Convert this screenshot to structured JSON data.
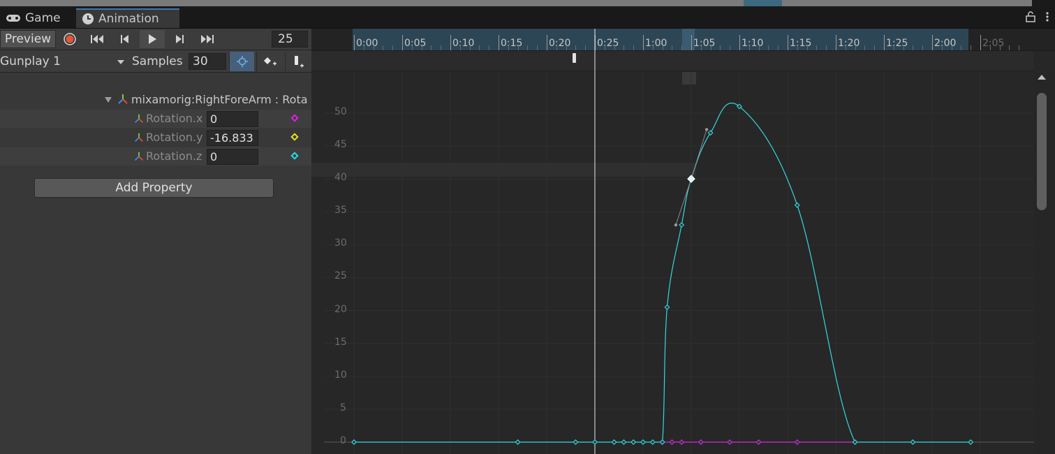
{
  "tabs": [
    {
      "label": "Game",
      "icon": "gamepad-icon"
    },
    {
      "label": "Animation",
      "icon": "clock-icon"
    }
  ],
  "toolbar": {
    "preview_label": "Preview",
    "current_frame": "25",
    "clip_name": "Gunplay 1",
    "samples_label": "Samples",
    "samples_value": "30"
  },
  "properties": {
    "header": "mixamorig:RightForeArm : Rota",
    "rows": [
      {
        "name": "Rotation.x",
        "value": "0",
        "color": "#e020e0"
      },
      {
        "name": "Rotation.y",
        "value": "-16.833",
        "color": "#e8e020"
      },
      {
        "name": "Rotation.z",
        "value": "0",
        "color": "#20e0e8"
      }
    ],
    "add_button": "Add Property"
  },
  "timeline": {
    "ticks": [
      "0:00",
      "0:05",
      "0:10",
      "0:15",
      "0:20",
      "0:25",
      "1:00",
      "1:05",
      "1:10",
      "1:15",
      "1:20",
      "1:25",
      "2:00",
      "2:05"
    ]
  },
  "chart_data": {
    "type": "line",
    "y_ticks": [
      "0",
      "5",
      "10",
      "15",
      "20",
      "25",
      "30",
      "35",
      "40",
      "45",
      "50"
    ],
    "ylim": [
      0,
      52
    ],
    "x_units": "frames",
    "playhead_frame": 25,
    "series": [
      {
        "color": "#36d8de",
        "keys_x": [
          0,
          17,
          23,
          25,
          27,
          28,
          29,
          30,
          31,
          32,
          32.5,
          34,
          35,
          37,
          40,
          46,
          52,
          58,
          64
        ],
        "keys_y": [
          0,
          0,
          0,
          0,
          0,
          0,
          0,
          0,
          0,
          0,
          20.5,
          33,
          40,
          47,
          51,
          36,
          0,
          0,
          0
        ]
      },
      {
        "color": "#d628d6",
        "keys_x": [
          32,
          33,
          34,
          36,
          39,
          42,
          46,
          52
        ],
        "keys_y": [
          0,
          0,
          0,
          0,
          0,
          0,
          0,
          0
        ]
      }
    ]
  }
}
